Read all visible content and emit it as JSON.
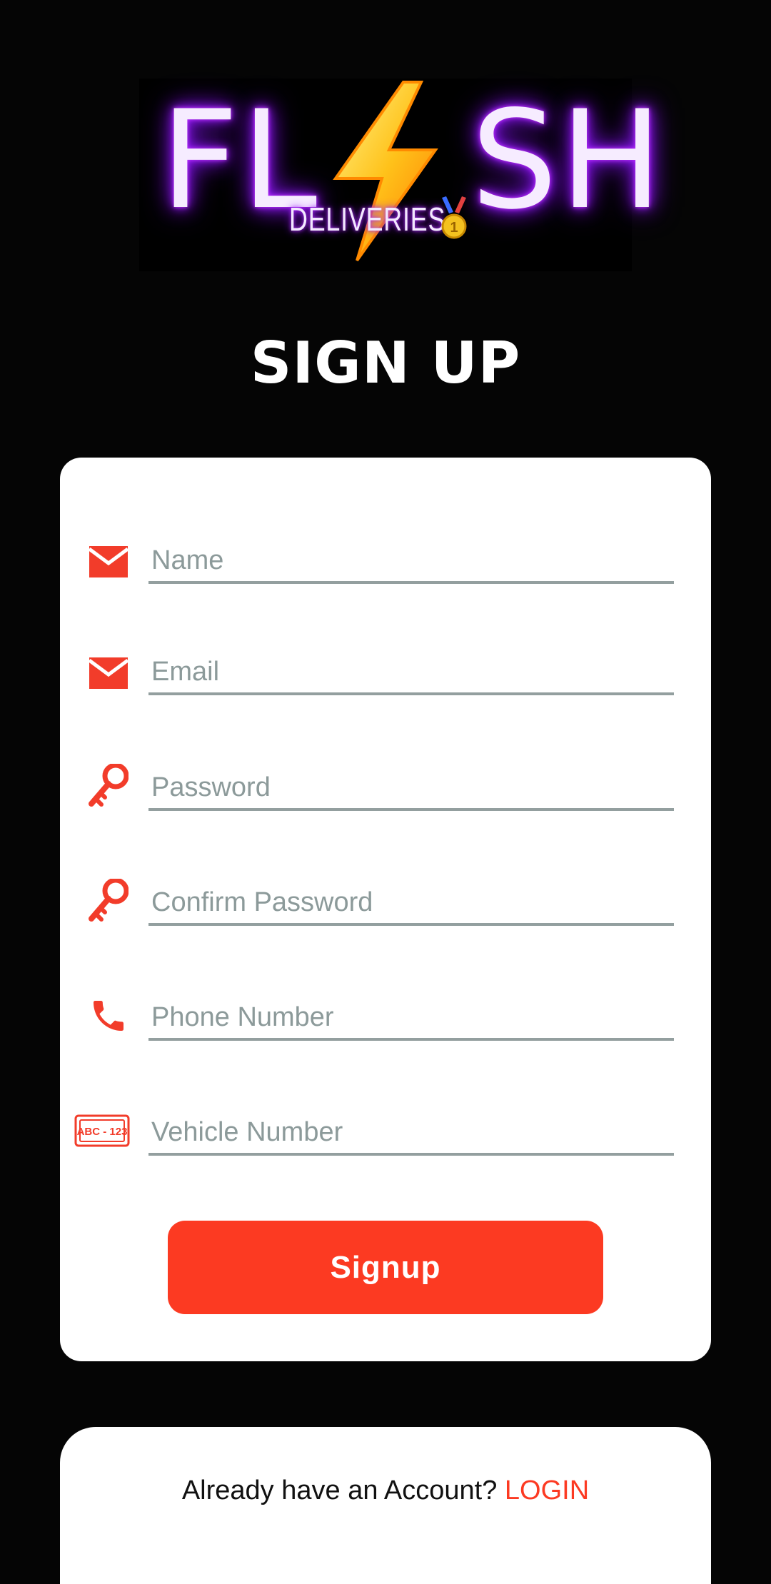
{
  "logo": {
    "left_letters": "FL",
    "right_letters": "SH",
    "subtitle": "DELIVERIES",
    "medal_number": "1"
  },
  "title": "SIGN UP",
  "form": {
    "fields": [
      {
        "placeholder": "Name",
        "icon": "envelope-icon"
      },
      {
        "placeholder": "Email",
        "icon": "envelope-icon"
      },
      {
        "placeholder": "Password",
        "icon": "key-icon"
      },
      {
        "placeholder": "Confirm Password",
        "icon": "key-icon"
      },
      {
        "placeholder": "Phone Number",
        "icon": "phone-icon"
      },
      {
        "placeholder": "Vehicle Number",
        "icon": "license-plate-icon"
      }
    ],
    "plate_text": "ABC - 123",
    "submit_label": "Signup"
  },
  "footer": {
    "prompt": "Already have an Account?",
    "login_label": "LOGIN"
  },
  "colors": {
    "accent": "#fc3a22",
    "background": "#050505",
    "card": "#ffffff",
    "underline": "#939f9f",
    "neon": "#9a1cff"
  }
}
